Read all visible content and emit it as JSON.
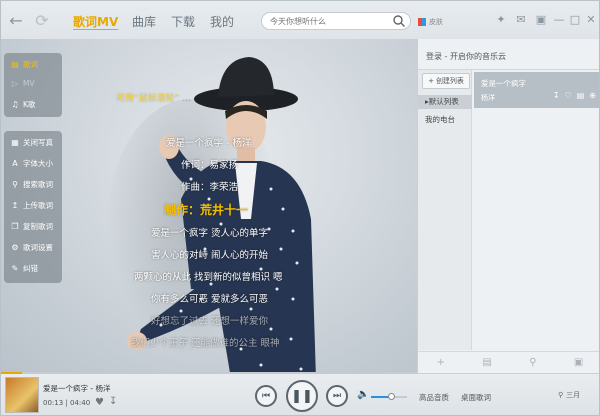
{
  "topbar": {
    "tabs": [
      {
        "label": "歌词MV"
      },
      {
        "label": "曲库"
      },
      {
        "label": "下载"
      },
      {
        "label": "我的"
      }
    ],
    "search_placeholder": "今天你想听什么",
    "skin_label": "皮肤"
  },
  "sidebar": {
    "top_items": [
      {
        "label": "歌词",
        "icon": "lyrics-icon"
      },
      {
        "label": "MV",
        "icon": "mv-icon"
      },
      {
        "label": "K歌",
        "icon": "mic-icon"
      }
    ],
    "tools": [
      {
        "label": "关闭写真",
        "icon": "photo-icon"
      },
      {
        "label": "字体大小",
        "icon": "font-icon"
      },
      {
        "label": "搜索歌词",
        "icon": "search-icon"
      },
      {
        "label": "上传歌词",
        "icon": "upload-icon"
      },
      {
        "label": "复制歌词",
        "icon": "copy-icon"
      },
      {
        "label": "歌词设置",
        "icon": "gear-icon"
      },
      {
        "label": "纠错",
        "icon": "edit-icon"
      }
    ]
  },
  "lyrics": {
    "hint_main": "可用“鼠标滚轮”",
    "hint_extra": "...",
    "lines": [
      "爱是一个疯字 - 杨洋",
      "作词：易家扬",
      "作曲：李荣浩",
      "制作：荒井十一",
      "爱是一个疯字 烫人心的单字",
      "害人心的对峙 闹人心的开始",
      "两颗心的从此 找到新的似曾相识 嗯",
      "你有多么可恶 爱就多么可恶",
      "好想忘了过去 还想一样爱你",
      "我们少个王子 还能做谁的公主 眼神"
    ],
    "current_index": 3
  },
  "right_panel": {
    "title": "登录 - 开启你的音乐云",
    "new_list_label": "创建列表",
    "nav": [
      {
        "label": "默认列表",
        "active": true
      },
      {
        "label": "我的电台",
        "active": false
      }
    ],
    "song": {
      "title": "爱是一个疯字",
      "artist": "杨洋"
    }
  },
  "player": {
    "title": "爱是一个疯字 - 杨洋",
    "current_time": "00:13",
    "total_time": "04:40",
    "progress": 0.05,
    "volume": 0.55,
    "quality_label": "高品音质",
    "desktop_lyrics_label": "桌面歌词",
    "mode_label": "三月"
  }
}
